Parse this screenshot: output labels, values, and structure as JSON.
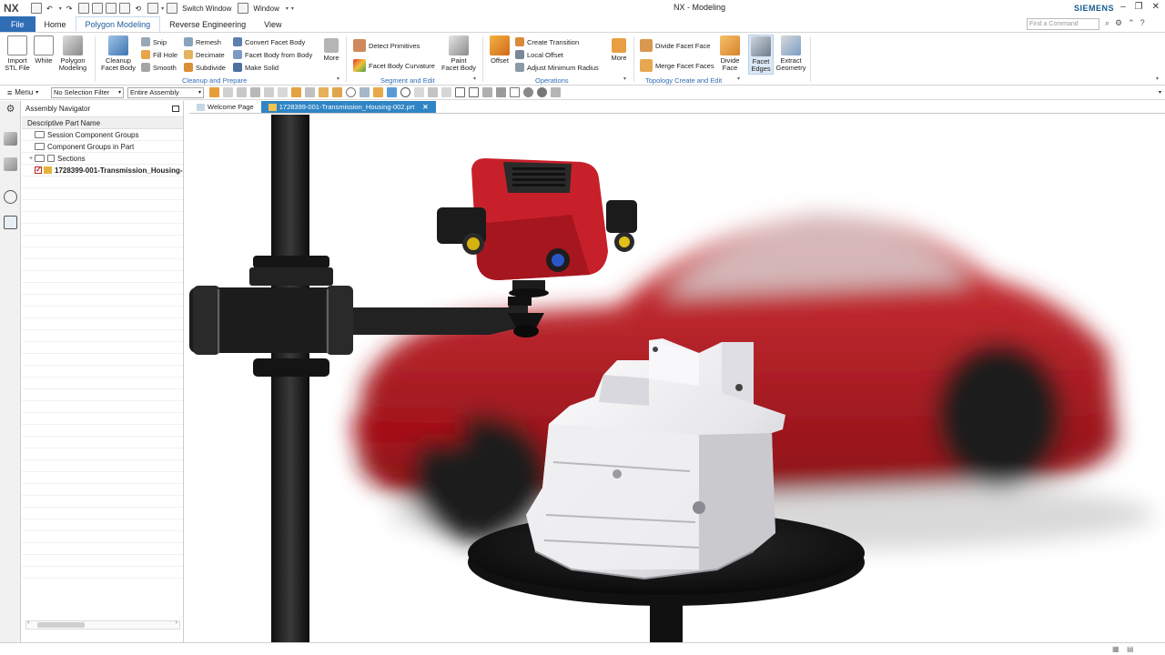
{
  "titlebar": {
    "logo": "NX",
    "switch_window": "Switch Window",
    "window": "Window",
    "title": "NX - Modeling",
    "brand": "SIEMENS"
  },
  "menu_tabs": [
    "File",
    "Home",
    "Polygon Modeling",
    "Reverse Engineering",
    "View"
  ],
  "command_finder": {
    "placeholder": "Find a Command"
  },
  "ribbon": {
    "import_stl": "Import\nSTL File",
    "white": "White",
    "polygon_modeling": "Polygon\nModeling",
    "cleanup_facet_body": "Cleanup\nFacet Body",
    "snip": "Snip",
    "fill_hole": "Fill Hole",
    "smooth": "Smooth",
    "remesh": "Remesh",
    "decimate": "Decimate",
    "subdivide": "Subdivide",
    "convert_facet_body": "Convert Facet Body",
    "facet_body_from_body": "Facet Body from Body",
    "make_solid": "Make Solid",
    "more1": "More",
    "group_cleanup": "Cleanup and Prepare",
    "detect_primitives": "Detect Primitives",
    "facet_body_curvature": "Facet Body Curvature",
    "paint_facet_body": "Paint\nFacet Body",
    "group_segment": "Segment and Edit",
    "offset": "Offset",
    "create_transition": "Create Transition",
    "local_offset": "Local Offset",
    "adjust_min_radius": "Adjust Minimum Radius",
    "more2": "More",
    "group_operations": "Operations",
    "divide_facet_face": "Divide Facet Face",
    "merge_facet_faces": "Merge Facet Faces",
    "divide_face": "Divide\nFace",
    "facet_edges": "Facet\nEdges",
    "extract_geometry": "Extract\nGeometry",
    "group_topology": "Topology Create and Edit"
  },
  "toolbar": {
    "menu": "Menu",
    "selection_filter": "No Selection Filter",
    "scope": "Entire Assembly"
  },
  "navigator": {
    "title": "Assembly Navigator",
    "column": "Descriptive Part Name",
    "rows": [
      "Session Component Groups",
      "Component Groups in Part",
      "Sections",
      "1728399-001-Transmission_Housing-"
    ]
  },
  "doc_tabs": {
    "welcome": "Welcome Page",
    "active": "1728399-001-Transmission_Housing-002.prt"
  },
  "colors": {
    "accent": "#2f6db5",
    "active_tab": "#2f85c5",
    "scanner_red": "#c8202a",
    "car_red": "#b8121d"
  }
}
